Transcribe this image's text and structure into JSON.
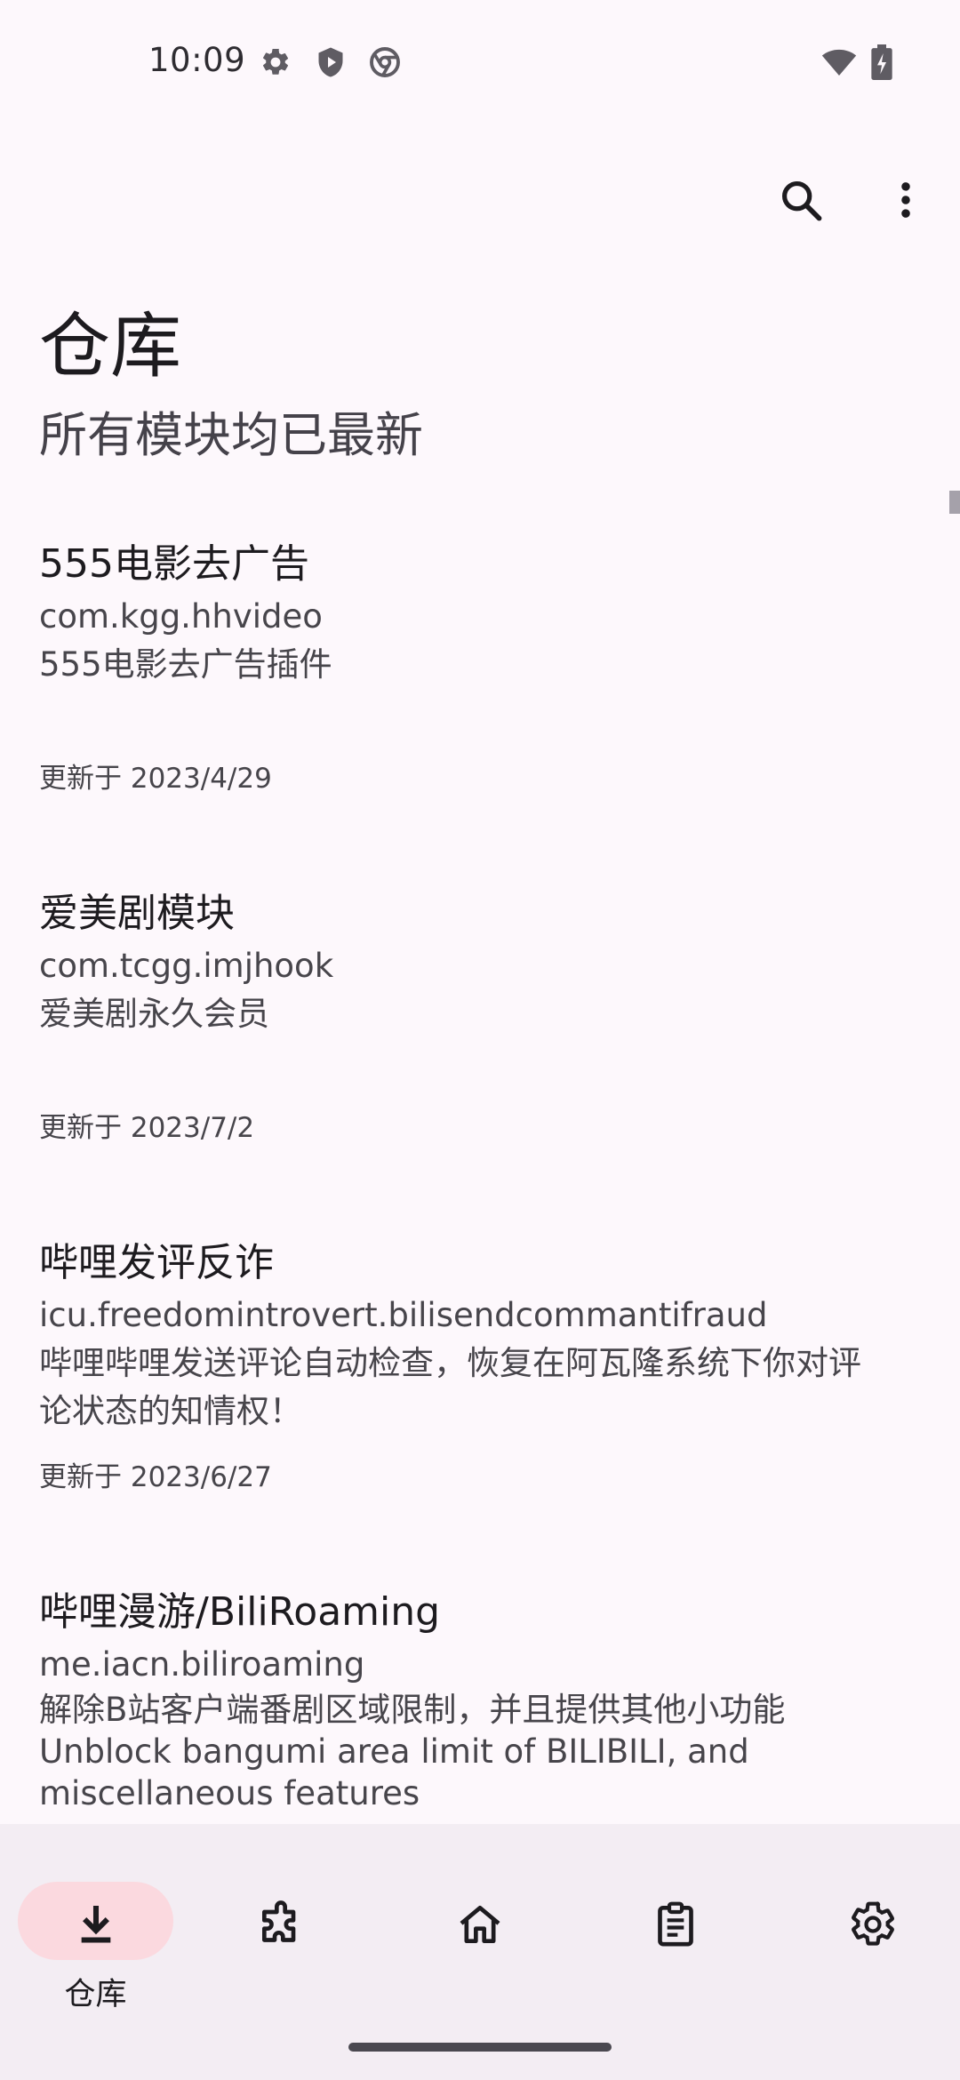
{
  "status_bar": {
    "time": "10:09",
    "icons": [
      "gear-icon",
      "shield-play-icon",
      "chrome-icon",
      "wifi-icon",
      "battery-charging-icon"
    ]
  },
  "app_bar": {
    "actions": [
      "search-icon",
      "more-vert-icon"
    ]
  },
  "header": {
    "title": "仓库",
    "subtitle": "所有模块均已最新"
  },
  "modules": [
    {
      "title": "555电影去广告",
      "package": "com.kgg.hhvideo",
      "description": "555电影去广告插件",
      "updated": "更新于 2023/4/29"
    },
    {
      "title": "爱美剧模块",
      "package": "com.tcgg.imjhook",
      "description": "爱美剧永久会员",
      "updated": "更新于 2023/7/2"
    },
    {
      "title": "哔哩发评反诈",
      "package": "icu.freedomintrovert.bilisendcommantifraud",
      "description": "哔哩哔哩发送评论自动检查，恢复在阿瓦隆系统下你对评论状态的知情权！",
      "updated": "更新于 2023/6/27"
    },
    {
      "title": "哔哩漫游/BiliRoaming",
      "package": "me.iacn.biliroaming",
      "description_lines": [
        "解除B站客户端番剧区域限制，并且提供其他小功能",
        "Unblock bangumi area limit of BILIBILI, and",
        "miscellaneous features"
      ]
    }
  ],
  "bottom_nav": {
    "items": [
      {
        "icon": "download-icon",
        "label": "仓库",
        "selected": true
      },
      {
        "icon": "puzzle-icon",
        "selected": false
      },
      {
        "icon": "home-icon",
        "selected": false
      },
      {
        "icon": "clipboard-icon",
        "selected": false
      },
      {
        "icon": "settings-icon",
        "selected": false
      }
    ]
  },
  "colors": {
    "background": "#fdf8fc",
    "nav_background": "#f3edf3",
    "nav_indicator": "#fbd9df",
    "text_primary": "#1d1b1f",
    "text_secondary": "#47454b"
  }
}
